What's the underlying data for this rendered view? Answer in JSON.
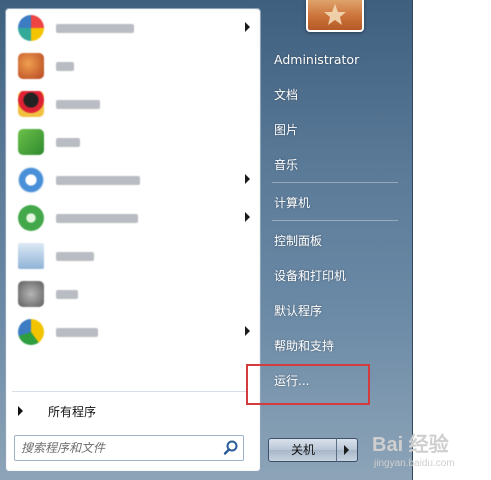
{
  "start_menu": {
    "programs": [
      {
        "label": "",
        "icon": "colorful-ball-app-icon",
        "color": "#e86fb2",
        "has_submenu": true
      },
      {
        "label": "",
        "icon": "orange-app-icon",
        "color": "#c7542c",
        "has_submenu": false
      },
      {
        "label": "",
        "icon": "penguin-qq-icon",
        "color": "#c0392b",
        "has_submenu": false
      },
      {
        "label": "",
        "icon": "green-app-icon",
        "color": "#4aa845",
        "has_submenu": false
      },
      {
        "label": "",
        "icon": "blue-circle-app-icon",
        "color": "#3b7cc2",
        "has_submenu": true
      },
      {
        "label": "",
        "icon": "green-circle-app-icon",
        "color": "#42a84a",
        "has_submenu": true
      },
      {
        "label": "",
        "icon": "document-app-icon",
        "color": "#8fb3d6",
        "has_submenu": false
      },
      {
        "label": "",
        "icon": "gray-app-icon",
        "color": "#7a7a7a",
        "has_submenu": false
      },
      {
        "label": "",
        "icon": "yellow-green-app-icon",
        "color": "#d6b422",
        "has_submenu": true
      }
    ],
    "all_programs_label": "所有程序",
    "search_placeholder": "搜索程序和文件",
    "right_items": [
      "Administrator",
      "文档",
      "图片",
      "音乐",
      "计算机",
      "控制面板",
      "设备和打印机",
      "默认程序",
      "帮助和支持",
      "运行..."
    ],
    "shutdown_label": "关机"
  },
  "watermark": {
    "logo_text": "Bai 经验",
    "sub_text": "jingyan.baidu.com"
  }
}
